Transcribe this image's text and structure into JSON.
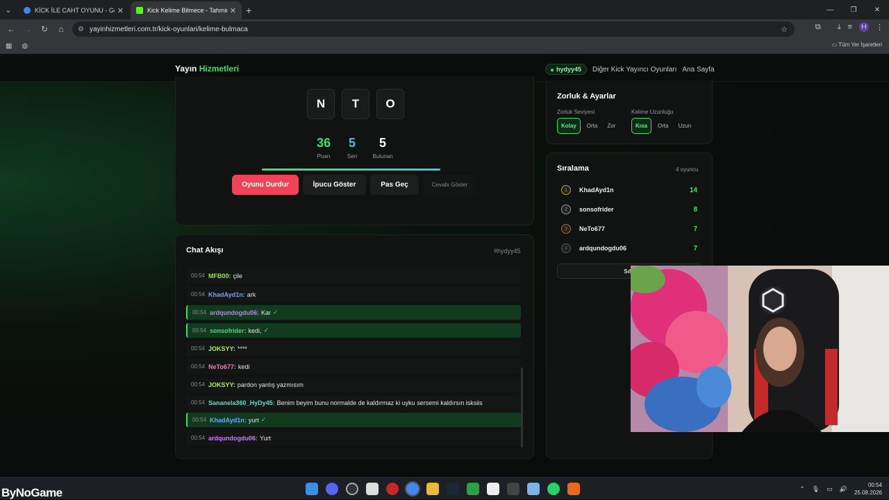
{
  "browser": {
    "tabs": [
      {
        "title": "KİCK İLE CAHT OYUNU - Goog",
        "active": false
      },
      {
        "title": "Kick Kelime Bilmece - Tahmin O",
        "active": true
      }
    ],
    "url": "yayinhizmetleri.com.tr/kick-oyunlari/kelime-bulmaca",
    "bookmarks_label": "Tüm Yer İşaretleri",
    "profile_initial": "H"
  },
  "site": {
    "brand_a": "Yayın",
    "brand_b": "Hizmetleri",
    "user": "hydyy45",
    "nav": [
      "Diğer Kick Yayıncı Oyunları",
      "Ana Sayfa"
    ]
  },
  "game": {
    "letters": [
      "N",
      "T",
      "O"
    ],
    "stats": [
      {
        "value": "36",
        "label": "Puan",
        "color": "#3ee06a"
      },
      {
        "value": "5",
        "label": "Seri",
        "color": "#3bc6e0"
      },
      {
        "value": "5",
        "label": "Bulunan",
        "color": "#ffffff"
      }
    ],
    "buttons": {
      "stop": "Oyunu Durdur",
      "hint": "İpucu Göster",
      "pass": "Pas Geç",
      "reveal": "Cevabı Göster"
    }
  },
  "chat": {
    "title": "Chat Akışı",
    "channel": "#hydyy45",
    "messages": [
      {
        "time": "00:54",
        "user": "MFB00:",
        "text": "çile",
        "color": "#9be05a",
        "ok": false
      },
      {
        "time": "00:54",
        "user": "KhadAyd1n:",
        "text": "ark",
        "color": "#6fa6ff",
        "ok": false
      },
      {
        "time": "00:54",
        "user": "ardqundogdu06:",
        "text": "Kar",
        "color": "#c77dff",
        "ok": true
      },
      {
        "time": "00:54",
        "user": "sonsofrider:",
        "text": "kedi,",
        "color": "#3ee06a",
        "ok": true
      },
      {
        "time": "00:54",
        "user": "JOKSYY:",
        "text": "****",
        "color": "#b3f04a",
        "ok": false
      },
      {
        "time": "00:54",
        "user": "NeTo677:",
        "text": "kedi",
        "color": "#ff7ab8",
        "ok": false
      },
      {
        "time": "00:54",
        "user": "JOKSYY:",
        "text": "pardon yanlış yazmısım",
        "color": "#b3f04a",
        "ok": false
      },
      {
        "time": "00:54",
        "user": "Sananela360_HyDy45:",
        "text": "Benim beyim bunu normalde de kaldırmaz ki uyku sersemi kaldırsın isksiis",
        "color": "#4de0c0",
        "ok": false
      },
      {
        "time": "00:54",
        "user": "KhadAyd1n:",
        "text": "yurt",
        "color": "#6fa6ff",
        "ok": true
      },
      {
        "time": "00:54",
        "user": "ardqundogdu06:",
        "text": "Yurt",
        "color": "#c77dff",
        "ok": false
      }
    ],
    "check": "✓"
  },
  "settings": {
    "title": "Zorluk & Ayarlar",
    "difficulty_label": "Zorluk Seviyesi",
    "difficulty": [
      "Kolay",
      "Orta",
      "Zor"
    ],
    "length_label": "Kelime Uzunluğu",
    "length": [
      "Kısa",
      "Orta",
      "Uzun"
    ]
  },
  "ranking": {
    "title": "Sıralama",
    "count": "4 oyuncu",
    "players": [
      {
        "rank": "1",
        "name": "KhadAyd1n",
        "score": "14"
      },
      {
        "rank": "2",
        "name": "sonsofrider",
        "score": "8"
      },
      {
        "rank": "3",
        "name": "NeTo677",
        "score": "7"
      },
      {
        "rank": "4",
        "name": "ardqundogdu06",
        "score": "7"
      }
    ],
    "reset": "Sıfır"
  },
  "taskbar": {
    "watermark": "ByNoGame",
    "time": "00:54",
    "date": "25.08.2026"
  }
}
